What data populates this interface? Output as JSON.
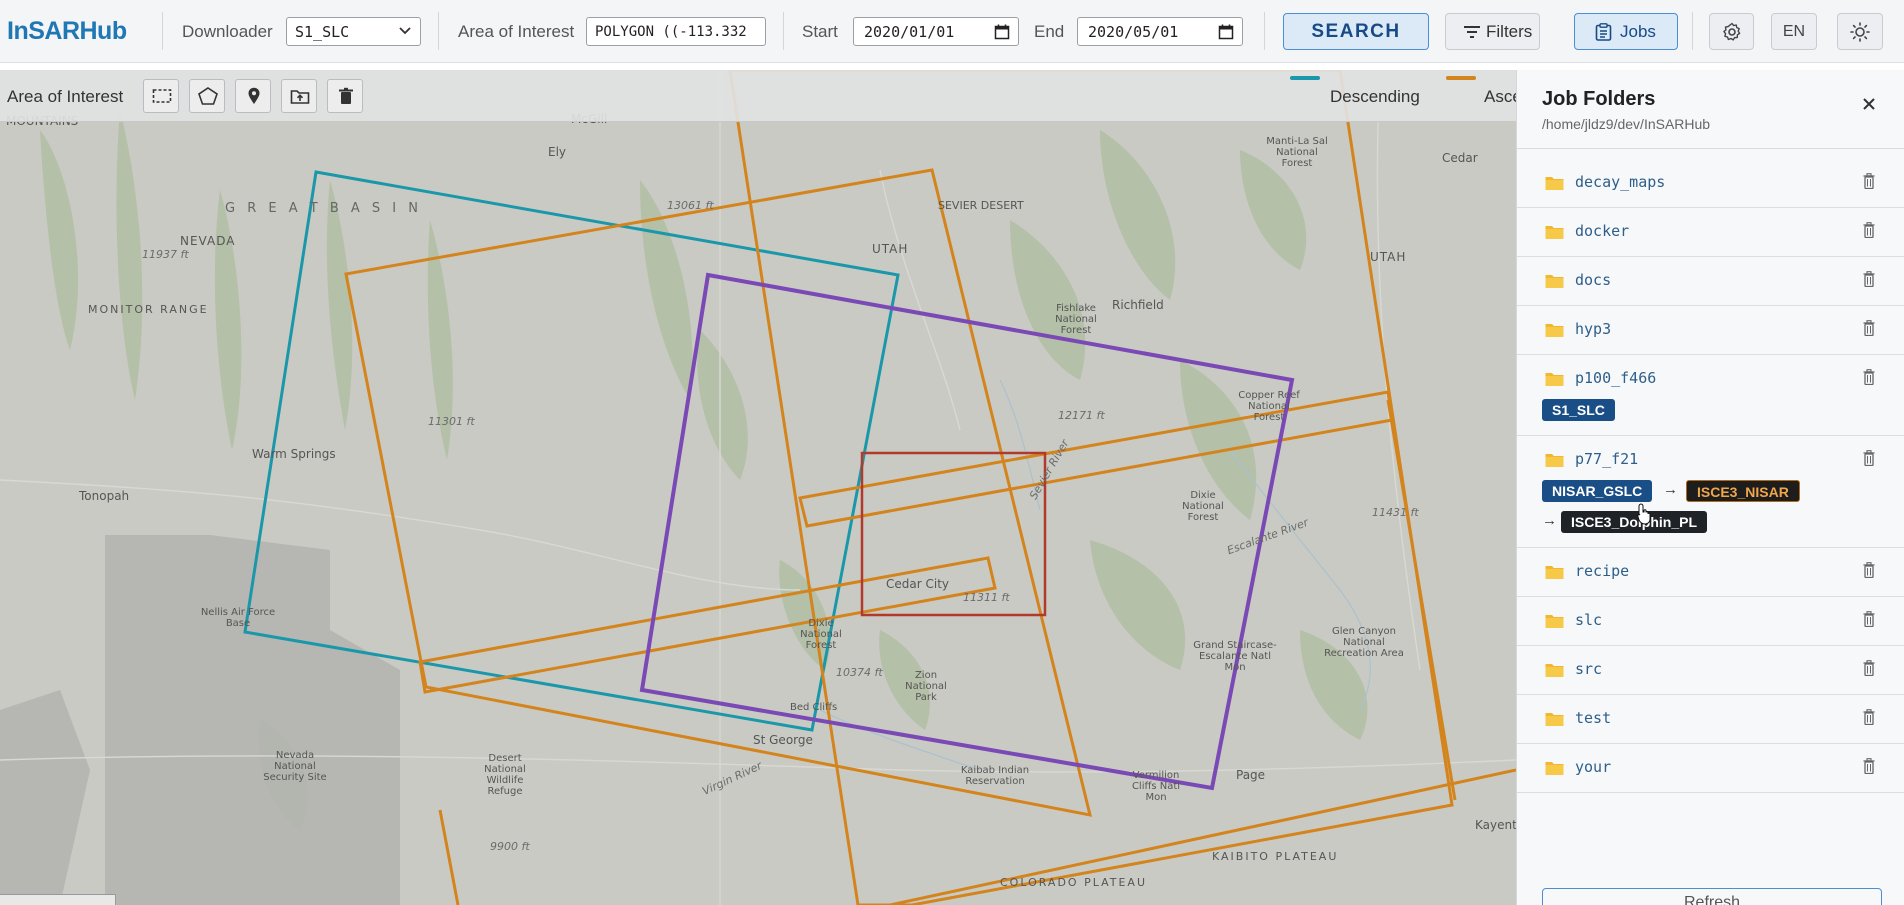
{
  "app": {
    "brand": "InSARHub"
  },
  "header": {
    "downloader_label": "Downloader",
    "downloader_value": "S1_SLC",
    "aoi_label": "Area of Interest",
    "aoi_value": "POLYGON ((-113.332",
    "start_label": "Start",
    "start_value": "2020/01/01",
    "end_label": "End",
    "end_value": "2020/05/01",
    "search_label": "SEARCH",
    "filters_label": "Filters",
    "jobs_label": "Jobs",
    "lang_label": "EN"
  },
  "map": {
    "toolbar_label": "Area of Interest",
    "tools": [
      "rectangle-icon",
      "polygon-icon",
      "pin-icon",
      "upload-folder-icon",
      "trash-icon"
    ],
    "legend": [
      {
        "label": "Descending",
        "color": "#1a98aa"
      },
      {
        "label": "Asce",
        "color": "#d4841c"
      }
    ],
    "labels": [
      "MOUNTAINS",
      "McGill",
      "Ely",
      "G R E A T   B A S I N",
      "NEVADA",
      "11937 ft",
      "MONITOR RANGE",
      "13061 ft",
      "UTAH",
      "SEVIER DESERT",
      "Richfield",
      "Fishlake National Forest",
      "Manti-La Sal National Forest",
      "Cedar",
      "UTAH",
      "11301 ft",
      "Warm Springs",
      "Tonopah",
      "12171 ft",
      "Copper Reef National Forest",
      "Dixie National Forest",
      "11431 ft",
      "Cedar City",
      "11311 ft",
      "Nellis Air Force Base",
      "Dixie National Forest",
      "10374 ft",
      "Zion National Park",
      "Grand Staircase-Escalante Natl Mon",
      "Glen Canyon National Recreation Area",
      "St George",
      "Kaibab Indian Reservation",
      "Vermilion Cliffs Natl Mon",
      "Page",
      "Nevada National Security Site",
      "Desert National Wildlife Refuge",
      "9900 ft",
      "KAIBITO PLATEAU",
      "COLORADO PLATEAU",
      "Kayenta",
      "Escalante River",
      "Virgin River",
      "Sevier River",
      "Bed Cliffs"
    ]
  },
  "panel": {
    "title": "Job Folders",
    "path": "/home/jldz9/dev/InSARHub",
    "folders": [
      {
        "name": "decay_maps"
      },
      {
        "name": "docker"
      },
      {
        "name": "docs"
      },
      {
        "name": "hyp3"
      },
      {
        "name": "p100_f466",
        "tags": [
          "S1_SLC"
        ]
      },
      {
        "name": "p77_f21",
        "tags": [
          "NISAR_GSLC",
          "ISCE3_NISAR",
          "ISCE3_Dolphin_PL"
        ]
      },
      {
        "name": "recipe"
      },
      {
        "name": "slc"
      },
      {
        "name": "src"
      },
      {
        "name": "test"
      },
      {
        "name": "your"
      }
    ],
    "arrow": "→",
    "refresh_label": "Refresh"
  }
}
